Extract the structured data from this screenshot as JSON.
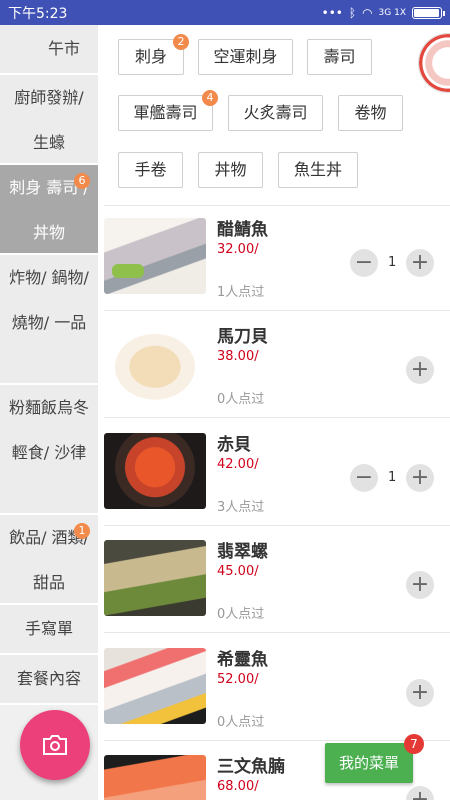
{
  "status_bar": {
    "time": "下午5:23",
    "signal": "3G 1X"
  },
  "sidebar": {
    "items": [
      {
        "label": "午市"
      },
      {
        "label": "廚師發辦/ 生蠔"
      },
      {
        "label": "刺身 壽司 / 丼物",
        "badge": "6"
      },
      {
        "label": "炸物/ 鍋物/ 燒物/ 一品"
      },
      {
        "label": "粉麵飯烏冬 輕食/ 沙律"
      },
      {
        "label": "飲品/ 酒類/甜品",
        "badge": "1"
      },
      {
        "label": "手寫單"
      },
      {
        "label": "套餐內容"
      }
    ]
  },
  "tags": [
    {
      "label": "刺身",
      "badge": "2"
    },
    {
      "label": "空運刺身"
    },
    {
      "label": "壽司"
    },
    {
      "label": "軍艦壽司",
      "badge": "4"
    },
    {
      "label": "火炙壽司"
    },
    {
      "label": "卷物"
    },
    {
      "label": "手卷"
    },
    {
      "label": "丼物"
    },
    {
      "label": "魚生丼"
    }
  ],
  "foods": [
    {
      "name": "醋鯖魚",
      "price": "32.00/",
      "count": "1人点过",
      "qty": "1"
    },
    {
      "name": "馬刀貝",
      "price": "38.00/",
      "count": "0人点过"
    },
    {
      "name": "赤貝",
      "price": "42.00/",
      "count": "3人点过",
      "qty": "1"
    },
    {
      "name": "翡翠螺",
      "price": "45.00/",
      "count": "0人点过"
    },
    {
      "name": "希靈魚",
      "price": "52.00/",
      "count": "0人点过"
    },
    {
      "name": "三文魚腩",
      "price": "68.00/"
    }
  ],
  "controls": {
    "minus": "−",
    "plus": "+"
  },
  "my_menu": {
    "label": "我的菜單",
    "badge": "7"
  },
  "colors": {
    "status_bar": "#3f51b5",
    "active_side": "#a8a8a8",
    "price": "#d0021b",
    "fab": "#ec407a",
    "menu_btn": "#4caf50"
  },
  "icons": {
    "camera": "camera-icon",
    "mascot": "mascot-logo"
  }
}
